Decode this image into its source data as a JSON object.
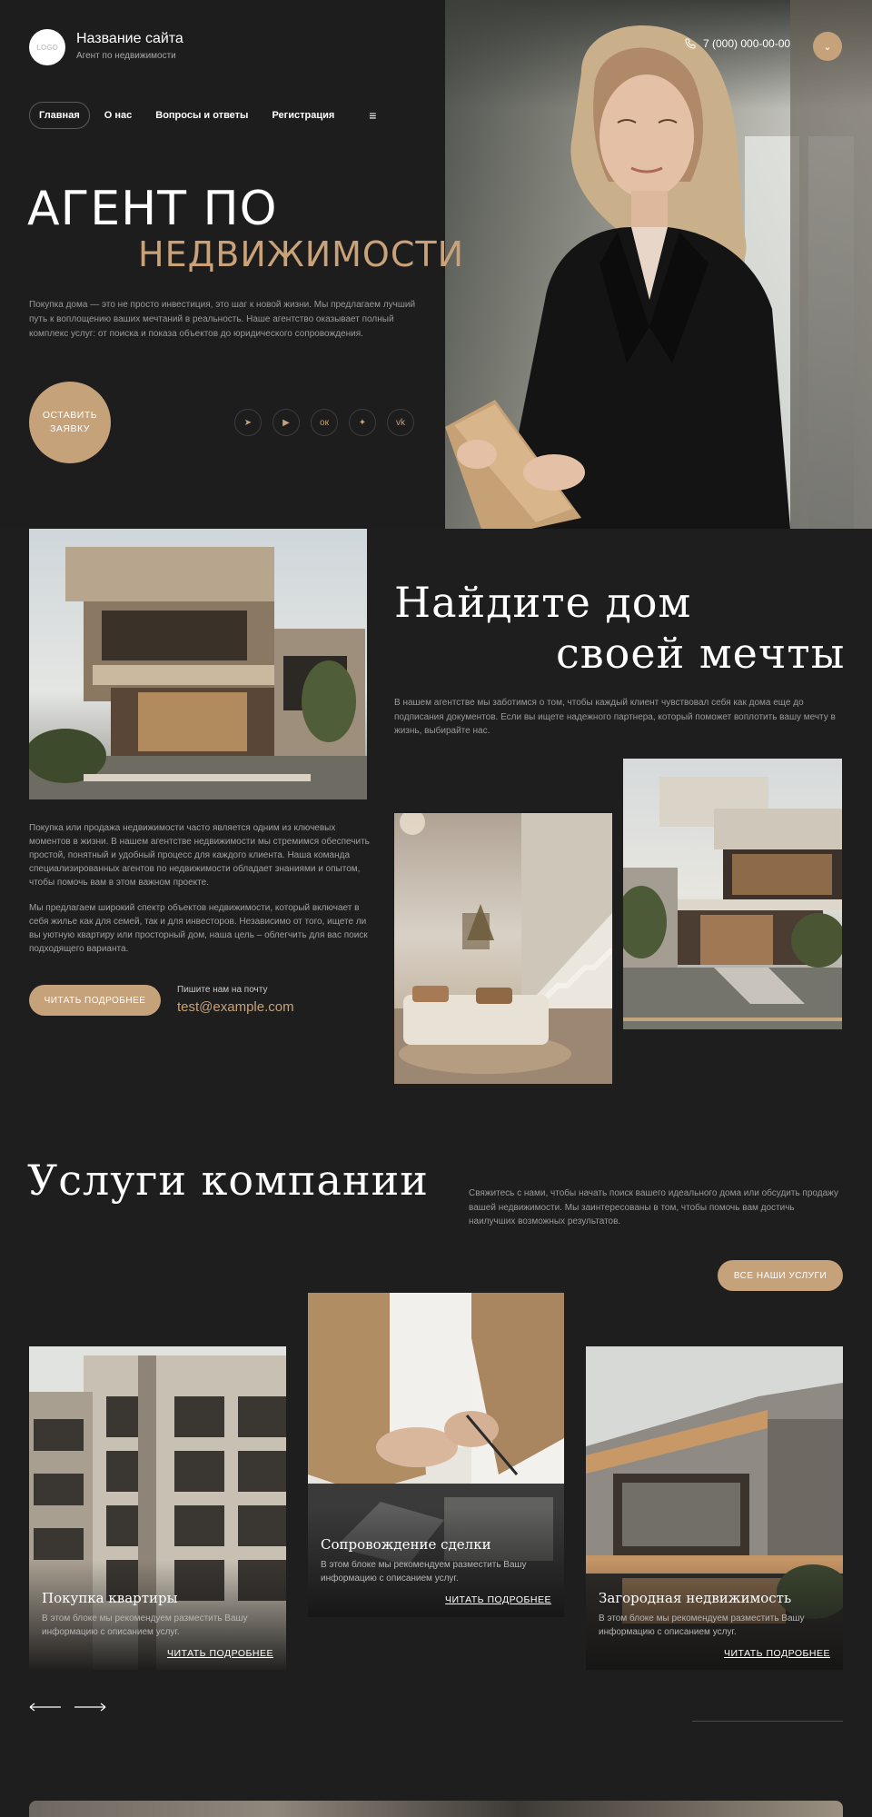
{
  "header": {
    "logo_text": "LOGO",
    "site_name": "Название сайта",
    "site_tagline": "Агент по недвижимости",
    "phone": "7 (000) 000-00-00",
    "nav": [
      {
        "label": "Главная",
        "active": true
      },
      {
        "label": "О нас",
        "active": false
      },
      {
        "label": "Вопросы и ответы",
        "active": false
      },
      {
        "label": "Регистрация",
        "active": false
      }
    ],
    "menu_icon": "≡"
  },
  "hero": {
    "title_line1": "АГЕНТ ПО",
    "title_line2": "НЕДВИЖИМОСТИ",
    "text": "Покупка дома — это не просто инвестиция, это шаг к новой жизни. Мы предлагаем лучший путь к воплощению ваших мечтаний в реальность. Наше агентство оказывает полный комплекс услуг: от поиска и показа объектов до юридического сопровождения.",
    "cta_label": "ОСТАВИТЬ ЗАЯВКУ",
    "socials": [
      {
        "name": "telegram-icon",
        "glyph": "➤"
      },
      {
        "name": "youtube-icon",
        "glyph": "▶"
      },
      {
        "name": "odnoklassniki-icon",
        "glyph": "ок"
      },
      {
        "name": "twitter-icon",
        "glyph": "✦"
      },
      {
        "name": "vk-icon",
        "glyph": "vk"
      }
    ]
  },
  "about": {
    "title_line1": "Найдите дом",
    "title_line2": "своей мечты",
    "lead": "В нашем агентстве мы заботимся о том, чтобы каждый клиент чувствовал себя как дома еще до подписания документов. Если вы ищете надежного партнера, который поможет воплотить вашу мечту в жизнь, выбирайте нас.",
    "paragraph1": "Покупка или продажа недвижимости часто является одним из ключевых моментов в жизни. В нашем агентстве недвижимости мы стремимся обеспечить простой, понятный и удобный процесс для каждого клиента. Наша команда специализированных агентов по недвижимости обладает знаниями и опытом, чтобы помочь вам в этом важном проекте.",
    "paragraph2": "Мы предлагаем широкий спектр объектов недвижимости, который включает в себя жилье как для семей, так и для инвесторов. Независимо от того, ищете ли вы уютную квартиру или просторный дом, наша цель – облегчить для вас поиск подходящего варианта.",
    "read_more_label": "ЧИТАТЬ ПОДРОБНЕЕ",
    "mail_label": "Пишите нам на почту",
    "email": "test@example.com"
  },
  "services": {
    "title": "Услуги компании",
    "lead": "Свяжитесь с нами, чтобы начать поиск вашего идеального дома или обсудить продажу вашей недвижимости. Мы заинтересованы в том, чтобы помочь вам достичь наилучших возможных результатов.",
    "all_label": "ВСЕ НАШИ УСЛУГИ",
    "cards": [
      {
        "title": "Покупка квартиры",
        "desc": "В этом блоке мы рекомендуем разместить Вашу информацию с описанием услуг.",
        "link": "ЧИТАТЬ ПОДРОБНЕЕ"
      },
      {
        "title": "Сопровождение сделки",
        "desc": "В этом блоке мы рекомендуем разместить Вашу информацию с описанием услуг.",
        "link": "ЧИТАТЬ ПОДРОБНЕЕ"
      },
      {
        "title": "Загородная недвижимость",
        "desc": "В этом блоке мы рекомендуем разместить Вашу информацию с описанием услуг.",
        "link": "ЧИТАТЬ ПОДРОБНЕЕ"
      }
    ]
  },
  "colors": {
    "accent": "#c6a27a",
    "background": "#1e1e1e",
    "text": "#ffffff"
  }
}
